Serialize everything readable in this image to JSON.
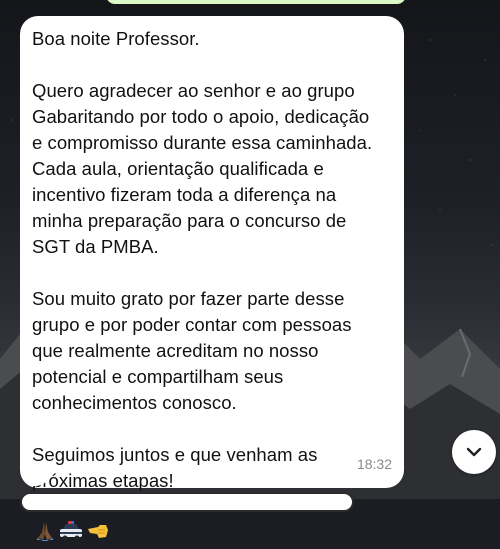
{
  "message": {
    "greeting": "Boa noite Professor.",
    "paragraph_1": "Quero agradecer ao senhor e ao grupo\nGabaritando por todo o apoio, dedicação\ne compromisso durante essa caminhada.\nCada aula, orientação qualificada e\nincentivo fizeram toda a diferença na\nminha preparação para o concurso de\nSGT da PMBA.",
    "paragraph_2": "Sou muito grato por fazer parte desse\ngrupo e por poder contar com pessoas\nque realmente acreditam no nosso\npotencial e compartilham seus\nconhecimentos conosco.",
    "closing_line_1": "Seguimos juntos e que venham as",
    "closing_line_2": "próximas etapas!",
    "emojis": [
      "praying-hands",
      "police-car",
      "backhand-index-pointing-left"
    ],
    "time": "18:32"
  },
  "scroll_button": {
    "icon": "chevron-down-icon"
  },
  "colors": {
    "bubble": "#ffffff",
    "text": "#111111",
    "timestamp": "#8a8a8a",
    "outgoing_bubble": "#dcf8c6"
  }
}
